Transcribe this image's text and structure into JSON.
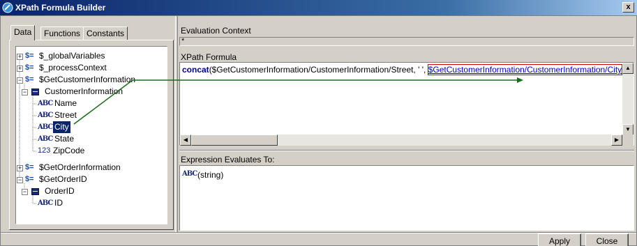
{
  "window": {
    "title": "XPath Formula Builder",
    "close_glyph": "x"
  },
  "tabs": [
    {
      "label": "Data",
      "active": true
    },
    {
      "label": "Functions",
      "active": false
    },
    {
      "label": "Constants",
      "active": false
    }
  ],
  "tree": {
    "nodes": [
      {
        "label": "$_globalVariables",
        "icon": "variable-icon",
        "expander": "+"
      },
      {
        "label": "$_processContext",
        "icon": "variable-icon",
        "expander": "+"
      },
      {
        "label": "$GetCustomerInformation",
        "icon": "variable-icon",
        "expander": "-"
      },
      {
        "label": "CustomerInformation",
        "icon": "complex-element-icon",
        "expander": "-"
      },
      {
        "label": "Name",
        "icon": "string-icon",
        "icon_text": "ABC"
      },
      {
        "label": "Street",
        "icon": "string-icon",
        "icon_text": "ABC"
      },
      {
        "label": "City",
        "icon": "string-icon",
        "icon_text": "ABC",
        "selected": true
      },
      {
        "label": "State",
        "icon": "string-icon",
        "icon_text": "ABC"
      },
      {
        "label": "ZipCode",
        "icon": "integer-icon",
        "icon_text": "123"
      },
      {
        "label": "$GetOrderInformation",
        "icon": "variable-icon",
        "expander": "+"
      },
      {
        "label": "$GetOrderID",
        "icon": "variable-icon",
        "expander": "-"
      },
      {
        "label": "OrderID",
        "icon": "complex-element-icon",
        "expander": "-"
      },
      {
        "label": "ID",
        "icon": "string-icon",
        "icon_text": "ABC"
      }
    ],
    "variable_glyph": "$="
  },
  "evaluation_context": {
    "label": "Evaluation Context",
    "value": "*"
  },
  "formula": {
    "label": "XPath Formula",
    "function_name": "concat",
    "part1": "($GetCustomerInformation/CustomerInformation/Street, ' ', ",
    "part2": "$GetCustomerInformation/CustomerInformation/City",
    "part3": ")"
  },
  "result": {
    "label": "Expression Evaluates To:",
    "type_icon_text": "ABC",
    "value": "(string)"
  },
  "buttons": {
    "apply": "Apply",
    "close": "Close"
  },
  "colors": {
    "title_bar": "#0a246a",
    "selection": "#0a246a",
    "drag_arrow": "#1a6b1a",
    "highlight_box": "#d00000"
  }
}
